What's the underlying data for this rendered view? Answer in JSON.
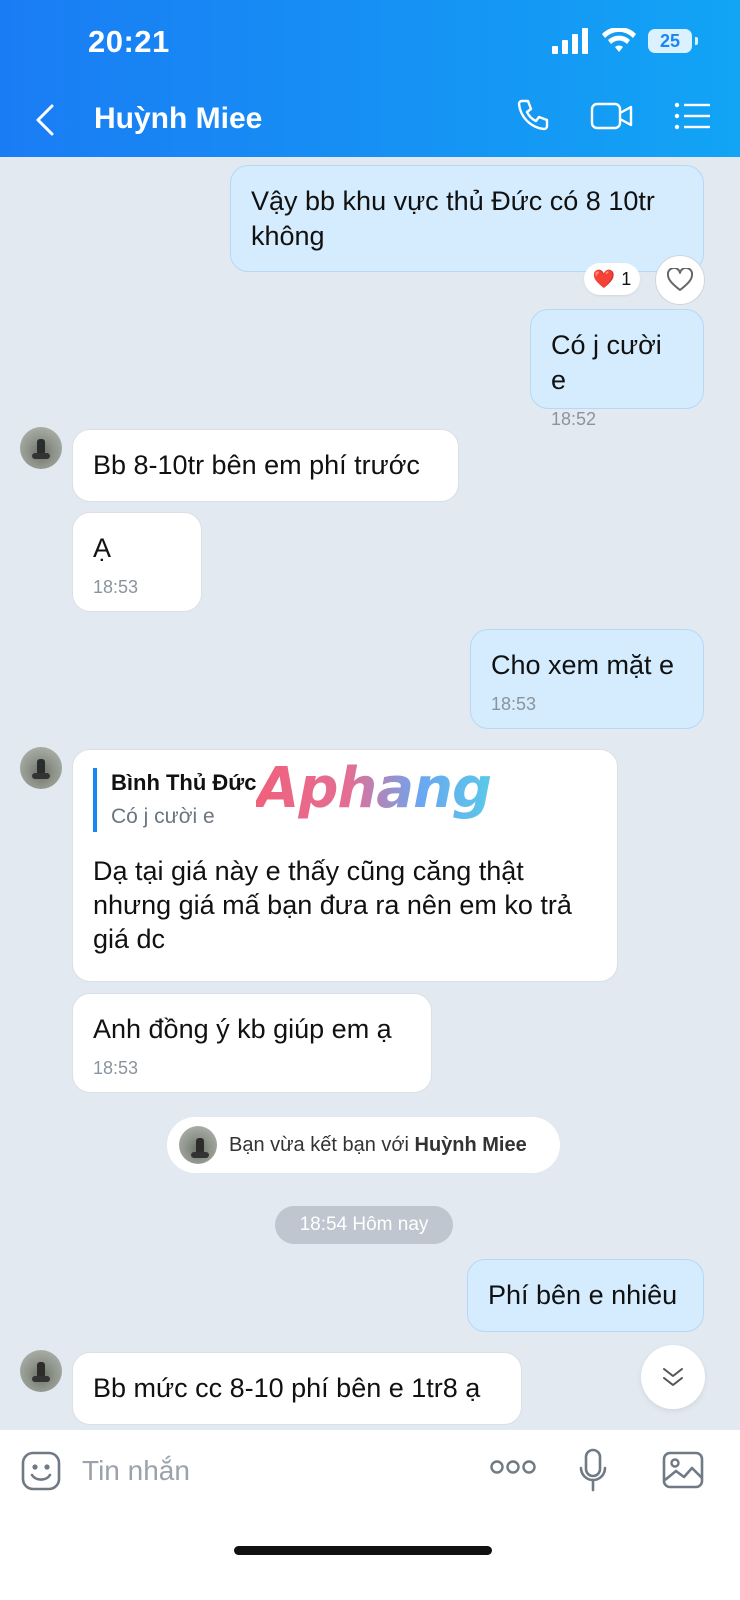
{
  "status_bar": {
    "time": "20:21",
    "battery": "25"
  },
  "nav": {
    "title": "Huỳnh Miee",
    "icons": [
      "back-chevron-icon",
      "phone-icon",
      "video-call-icon",
      "menu-list-icon"
    ]
  },
  "messages": [
    {
      "side": "mine",
      "text": "Vậy bb khu vực thủ Đức có 8 10tr không",
      "time": ""
    },
    {
      "side": "mine",
      "text": "Có j cười e",
      "time": "18:52"
    },
    {
      "side": "theirs",
      "text": "Bb 8-10tr bên em phí trước",
      "time": ""
    },
    {
      "side": "theirs",
      "text": "Ạ",
      "time": "18:53"
    },
    {
      "side": "mine",
      "text": "Cho xem mặt e",
      "time": "18:53"
    },
    {
      "side": "theirs",
      "quote_name": "Bình Thủ Đức",
      "quote_text": "Có j cười e",
      "text": "Dạ tại giá này e thấy cũng căng thật nhưng giá mấ bạn đưa ra nên em ko trả giá dc",
      "time": ""
    },
    {
      "side": "theirs",
      "text": "Anh đồng ý kb giúp em ạ",
      "time": "18:53"
    },
    {
      "side": "mine",
      "text": "Phí bên e nhiêu",
      "time": ""
    },
    {
      "side": "theirs",
      "text": "Bb mức cc 8-10 phí bên e 1tr8 ạ",
      "time": ""
    }
  ],
  "reaction": {
    "emoji": "❤️",
    "count": "1"
  },
  "watermark": "Aphang",
  "system": {
    "prefix": "Bạn vừa kết bạn với ",
    "name": "Huỳnh Miee"
  },
  "date_separator": "18:54 Hôm nay",
  "composer": {
    "placeholder": "Tin nhắn"
  }
}
